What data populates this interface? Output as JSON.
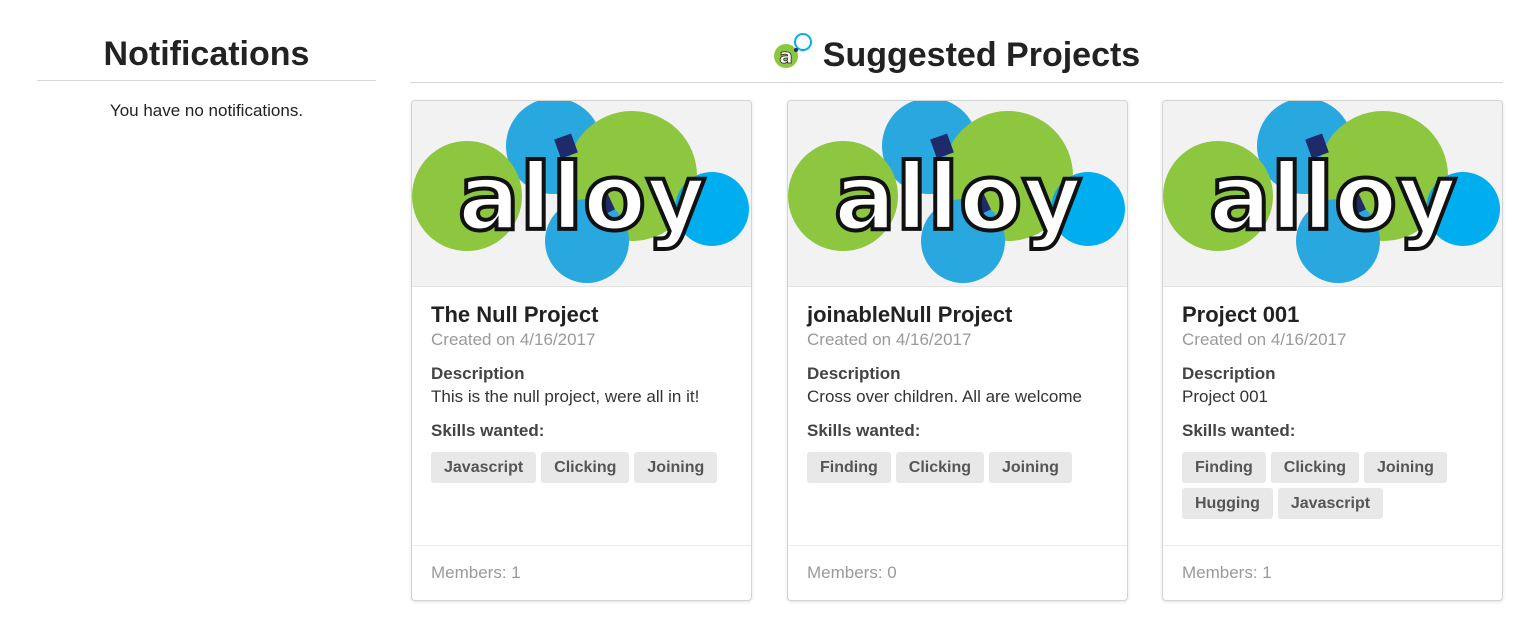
{
  "notifications": {
    "title": "Notifications",
    "empty_message": "You have no notifications."
  },
  "suggested": {
    "title": "Suggested Projects",
    "icon": "alloy-brand-icon",
    "projects": [
      {
        "title": "The Null Project",
        "created": "Created on 4/16/2017",
        "description_label": "Description",
        "description": "This is the null project, were all in it!",
        "skills_label": "Skills wanted:",
        "skills": [
          "Javascript",
          "Clicking",
          "Joining"
        ],
        "members": "Members: 1",
        "image_word": "alloy"
      },
      {
        "title": "joinableNull Project",
        "created": "Created on 4/16/2017",
        "description_label": "Description",
        "description": "Cross over children. All are welcome",
        "skills_label": "Skills wanted:",
        "skills": [
          "Finding",
          "Clicking",
          "Joining"
        ],
        "members": "Members: 0",
        "image_word": "alloy"
      },
      {
        "title": "Project 001",
        "created": "Created on 4/16/2017",
        "description_label": "Description",
        "description": "Project 001",
        "skills_label": "Skills wanted:",
        "skills": [
          "Finding",
          "Clicking",
          "Joining",
          "Hugging",
          "Javascript"
        ],
        "members": "Members: 1",
        "image_word": "alloy"
      }
    ]
  },
  "colors": {
    "logo_green": "#8dc63f",
    "logo_blue": "#29a8e0",
    "logo_cyan": "#00aeef",
    "logo_navy": "#1f2a6b",
    "tag_bg": "#e8e8e8"
  }
}
